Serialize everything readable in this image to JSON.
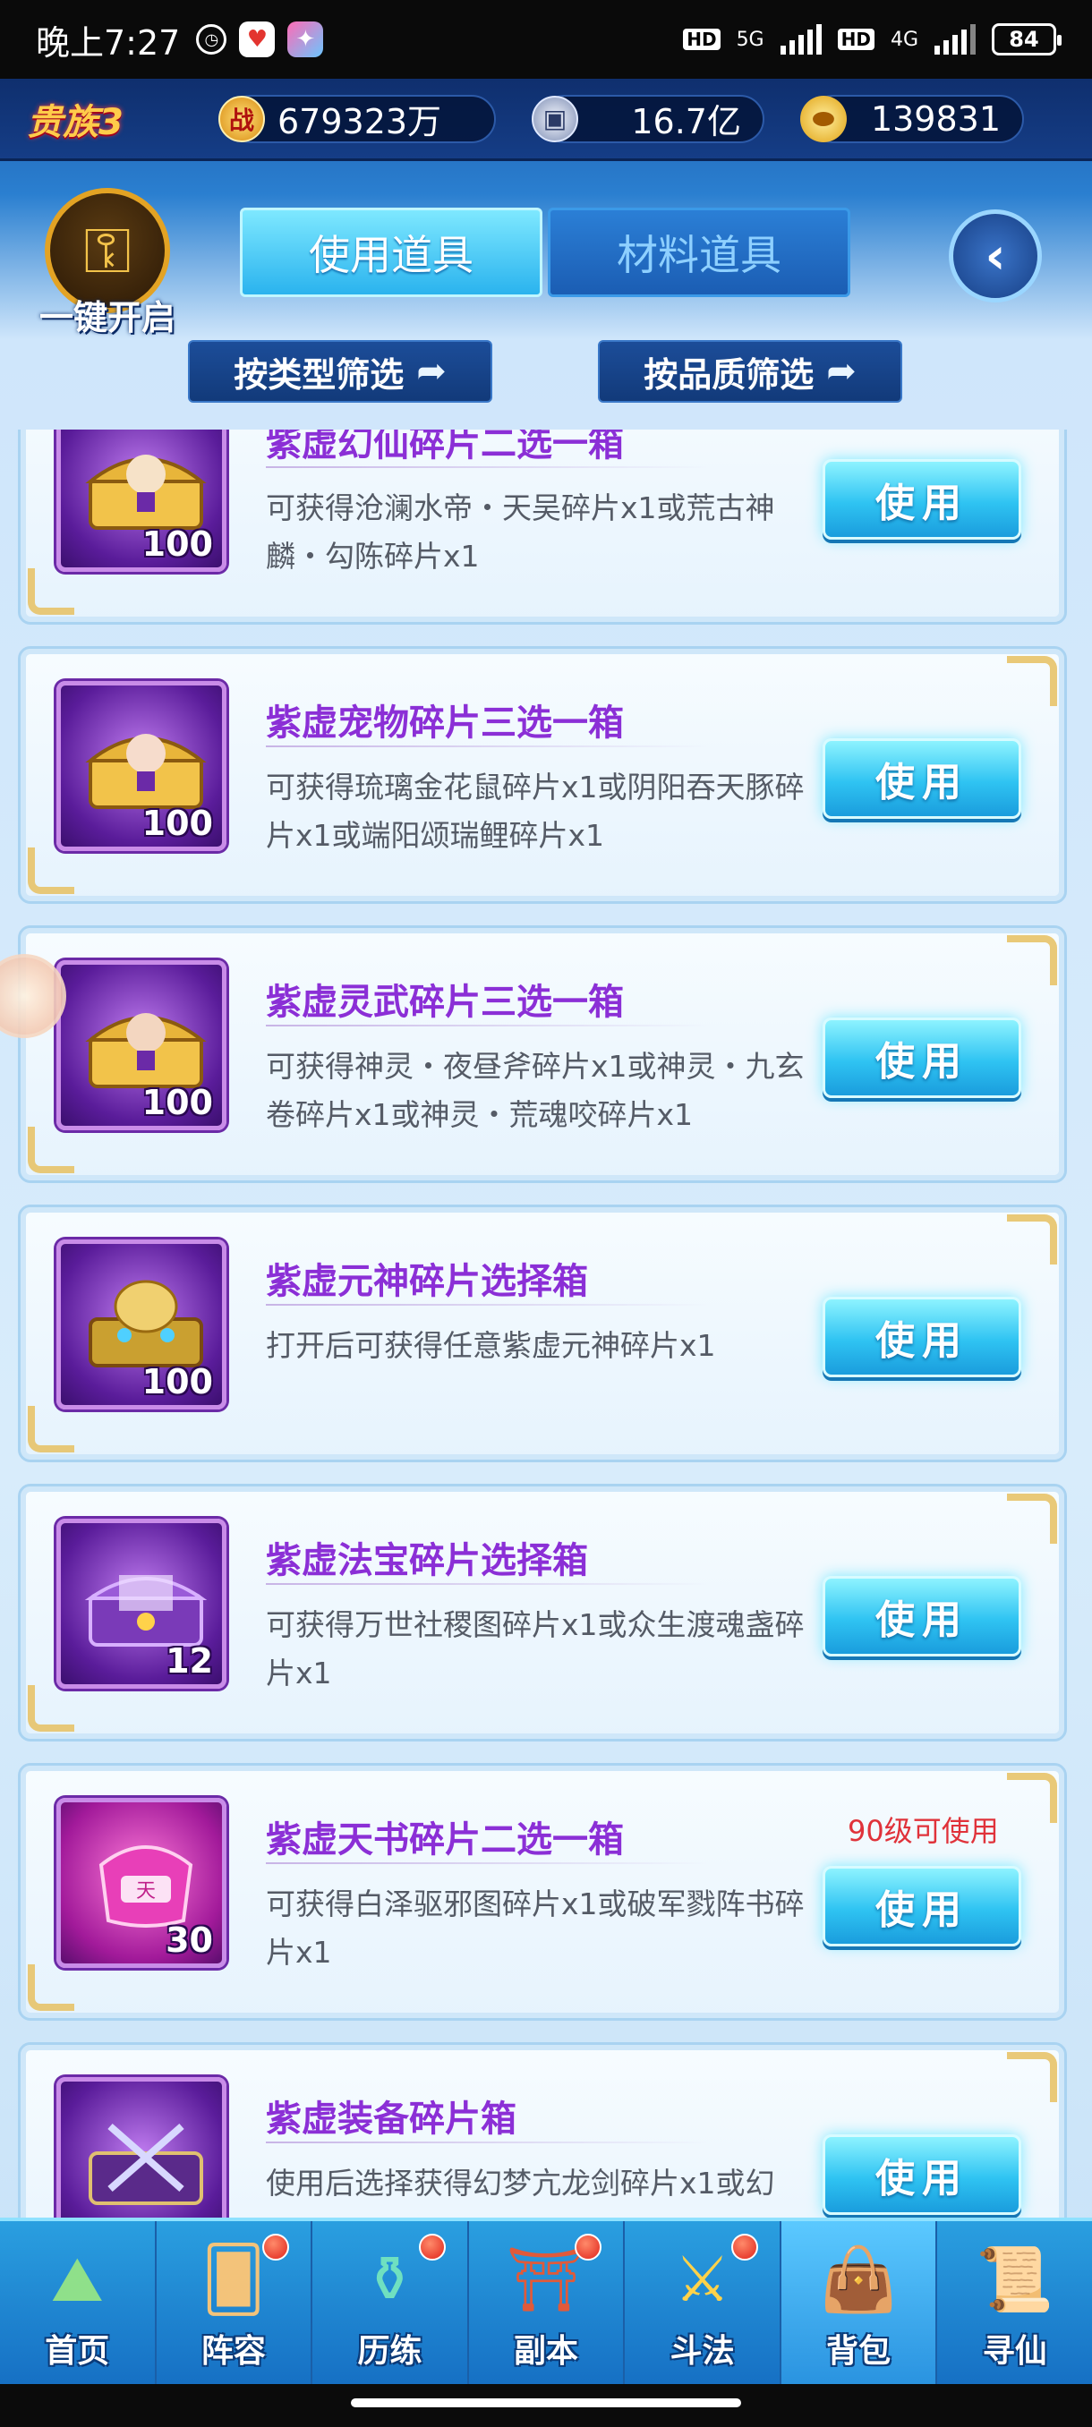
{
  "status_bar": {
    "time": "晚上7:27",
    "network1": "5G",
    "network2": "4G",
    "hd1": "HD",
    "hd2": "HD",
    "battery": "84"
  },
  "resources": {
    "noble": "贵族3",
    "power_icon": "战",
    "power": "679323万",
    "silver": "16.7亿",
    "gold": "139831"
  },
  "header": {
    "onekey_label": "一键开启",
    "tabs": [
      {
        "label": "使用道具",
        "active": true
      },
      {
        "label": "材料道具",
        "active": false
      }
    ],
    "filter_type": "按类型筛选",
    "filter_quality": "按品质筛选"
  },
  "items": [
    {
      "title": "紫虚幻仙碎片二选一箱",
      "desc": "可获得沧澜水帝・天吴碎片x1或荒古神麟・勾陈碎片x1",
      "count": "100",
      "button": "使用",
      "requirement": ""
    },
    {
      "title": "紫虚宠物碎片三选一箱",
      "desc": "可获得琉璃金花鼠碎片x1或阴阳吞天豚碎片x1或端阳颂瑞鲤碎片x1",
      "count": "100",
      "button": "使用",
      "requirement": ""
    },
    {
      "title": "紫虚灵武碎片三选一箱",
      "desc": "可获得神灵・夜昼斧碎片x1或神灵・九玄卷碎片x1或神灵・荒魂咬碎片x1",
      "count": "100",
      "button": "使用",
      "requirement": ""
    },
    {
      "title": "紫虚元神碎片选择箱",
      "desc": "打开后可获得任意紫虚元神碎片x1",
      "count": "100",
      "button": "使用",
      "requirement": ""
    },
    {
      "title": "紫虚法宝碎片选择箱",
      "desc": "可获得万世社稷图碎片x1或众生渡魂盏碎片x1",
      "count": "12",
      "button": "使用",
      "requirement": ""
    },
    {
      "title": "紫虚天书碎片二选一箱",
      "desc": "可获得白泽驱邪图碎片x1或破军戮阵书碎片x1",
      "count": "30",
      "button": "使用",
      "requirement": "90级可使用"
    },
    {
      "title": "紫虚装备碎片箱",
      "desc": "使用后选择获得幻梦亢龙剑碎片x1或幻",
      "count": "",
      "button": "使用",
      "requirement": ""
    }
  ],
  "nav": [
    {
      "label": "首页",
      "icon": "home-icon",
      "badge": false
    },
    {
      "label": "阵容",
      "icon": "lineup-icon",
      "badge": true
    },
    {
      "label": "历练",
      "icon": "training-icon",
      "badge": true
    },
    {
      "label": "副本",
      "icon": "dungeon-icon",
      "badge": true
    },
    {
      "label": "斗法",
      "icon": "battle-icon",
      "badge": true
    },
    {
      "label": "背包",
      "icon": "bag-icon",
      "badge": false,
      "active": true
    },
    {
      "label": "寻仙",
      "icon": "seek-icon",
      "badge": false
    }
  ],
  "colors": {
    "title_purple": "#8b2fd6",
    "use_button": "#2fc3f2",
    "requirement_red": "#e0323a",
    "nav_blue": "#1670c4"
  }
}
